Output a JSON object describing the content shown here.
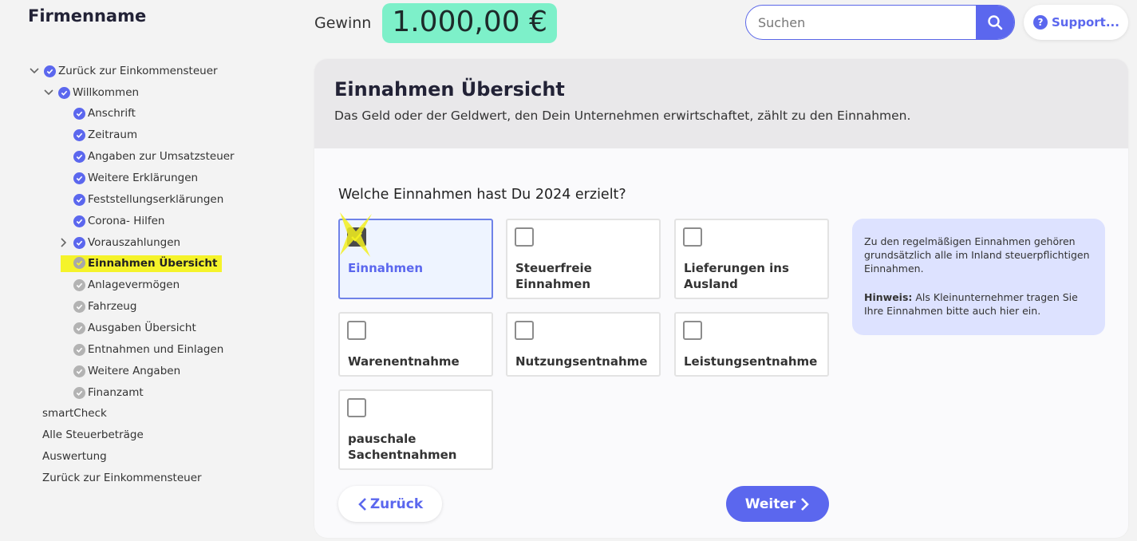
{
  "header": {
    "company_name": "Firmenname",
    "profit_label": "Gewinn",
    "profit_value": "1.000,00 €",
    "search_placeholder": "Suchen",
    "support_label": "Support..."
  },
  "sidebar": {
    "items": [
      {
        "label": "Zurück zur Einkommensteuer",
        "status": "done",
        "expanded": true
      },
      {
        "label": "Willkommen",
        "status": "done",
        "expanded": true
      },
      {
        "label": "Anschrift",
        "status": "done"
      },
      {
        "label": "Zeitraum",
        "status": "done"
      },
      {
        "label": "Angaben zur Umsatzsteuer",
        "status": "done"
      },
      {
        "label": "Weitere Erklärungen",
        "status": "done"
      },
      {
        "label": "Feststellungserklärungen",
        "status": "done"
      },
      {
        "label": "Corona- Hilfen",
        "status": "done"
      },
      {
        "label": "Vorauszahlungen",
        "status": "done",
        "expanded": false
      },
      {
        "label": "Einnahmen Übersicht",
        "status": "active"
      },
      {
        "label": "Anlagevermögen",
        "status": "todo"
      },
      {
        "label": "Fahrzeug",
        "status": "todo"
      },
      {
        "label": "Ausgaben Übersicht",
        "status": "todo"
      },
      {
        "label": "Entnahmen und Einlagen",
        "status": "todo"
      },
      {
        "label": "Weitere Angaben",
        "status": "todo"
      },
      {
        "label": "Finanzamt",
        "status": "todo"
      },
      {
        "label": "smartCheck"
      },
      {
        "label": "Alle Steuerbeträge"
      },
      {
        "label": "Auswertung"
      },
      {
        "label": "Zurück zur Einkommensteuer"
      }
    ]
  },
  "main": {
    "title": "Einnahmen Übersicht",
    "subtitle": "Das Geld oder der Geldwert, den Dein Unternehmen erwirtschaftet, zählt zu den Einnahmen.",
    "question": "Welche Einnahmen hast Du 2024 erzielt?",
    "options": [
      {
        "label": "Einnahmen",
        "checked": true
      },
      {
        "label": "Steuerfreie Einnahmen",
        "checked": false
      },
      {
        "label": "Lieferungen ins Ausland",
        "checked": false
      },
      {
        "label": "Warenentnahme",
        "checked": false
      },
      {
        "label": "Nutzungsentnahme",
        "checked": false
      },
      {
        "label": "Leistungsentnahme",
        "checked": false
      },
      {
        "label": "pauschale Sachentnahmen",
        "checked": false
      }
    ],
    "info_text": "Zu den regelmäßigen Einnahmen gehören grundsätzlich alle im Inland steuerpflichtigen Einnahmen.",
    "info_hint_label": "Hinweis:",
    "info_hint_text": " Als Kleinunternehmer tragen Sie Ihre Einnahmen bitte auch hier ein.",
    "back_label": "Zurück",
    "next_label": "Weiter"
  },
  "colors": {
    "accent": "#5b67ee",
    "profit_bg": "#7df0c9",
    "highlight": "#f5f32a",
    "info_bg": "#dde2ff"
  }
}
